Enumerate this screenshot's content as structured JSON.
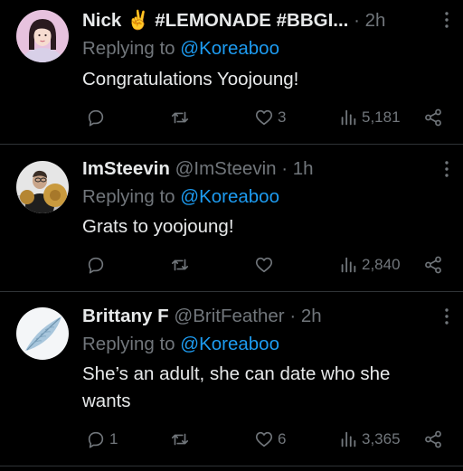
{
  "tweets": [
    {
      "name": "Nick ✌️ #LEMONADE #BBGI...",
      "handle": "",
      "time": "2h",
      "reply_prefix": "Replying to",
      "reply_to": "@Koreaboo",
      "text": "Congratulations Yoojoung!",
      "replies": "",
      "likes": "3",
      "views": "5,181",
      "avatar": "avatar-girl-pink-bg"
    },
    {
      "name": "ImSteevin",
      "handle": "@ImSteevin",
      "time": "1h",
      "reply_prefix": "Replying to",
      "reply_to": "@Koreaboo",
      "text": "Grats to yoojoung!",
      "replies": "",
      "likes": "",
      "views": "2,840",
      "avatar": "avatar-person-cymbals"
    },
    {
      "name": "Brittany F",
      "handle": "@BritFeather",
      "time": "2h",
      "reply_prefix": "Replying to",
      "reply_to": "@Koreaboo",
      "text": "She’s an adult, she can date who she wants",
      "replies": "1",
      "likes": "6",
      "views": "3,365",
      "avatar": "avatar-blue-feather"
    }
  ],
  "colors": {
    "background": "#000000",
    "primary_text": "#e7e9ea",
    "secondary_text": "#71767b",
    "link": "#1d9bf0",
    "divider": "#2f3336"
  },
  "icons": [
    "reply-icon",
    "retweet-icon",
    "like-icon",
    "views-icon",
    "share-icon",
    "more-icon"
  ]
}
